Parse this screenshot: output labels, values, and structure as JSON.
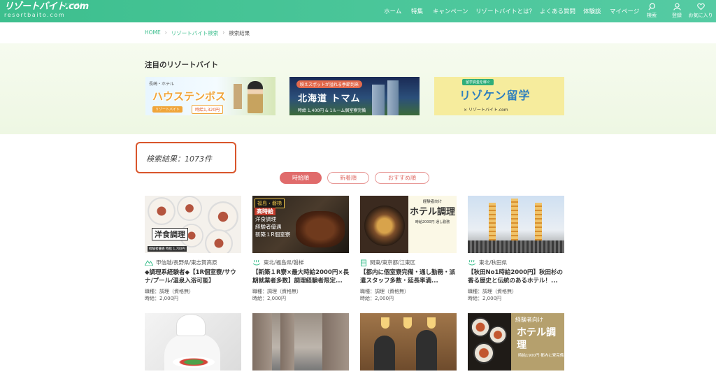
{
  "header": {
    "logo_text": "リゾートバイト.com",
    "logo_dotcom": "ドットコム",
    "logo_sub": "resortbaito.com",
    "nav": [
      {
        "label": "ホーム"
      },
      {
        "label": "特集"
      },
      {
        "label": "キャンペーン"
      },
      {
        "label": "リゾートバイトとは？"
      },
      {
        "label": "よくある質問"
      },
      {
        "label": "体験談"
      },
      {
        "label": "マイページ"
      }
    ],
    "icons": [
      {
        "label": "検索",
        "icon": "search-icon"
      },
      {
        "label": "登録",
        "icon": "user-icon"
      },
      {
        "label": "お気に入り",
        "icon": "heart-icon"
      }
    ]
  },
  "breadcrumb": {
    "home": "HOME",
    "section": "リゾートバイト検索",
    "current": "検索結果",
    "separator": "›"
  },
  "featured": {
    "title": "注目のリゾートバイト",
    "banners": [
      {
        "main": "ハウステンボス",
        "tag": "長崎・ホテル",
        "pill1": "リゾートバイト",
        "pill2": "時給1,320円"
      },
      {
        "tag": "映えスポットが溢れる季節到来",
        "main": "北海道 トマム",
        "sub": "時給 1,400円 & 1ルーム個室寮完備"
      },
      {
        "tag": "留学資金を稼ぐ",
        "main": "リゾケン留学",
        "sub": "× リゾートバイト.com"
      }
    ]
  },
  "results": {
    "count_text": "検索結果：1073件"
  },
  "sort": {
    "options": [
      {
        "label": "時給順",
        "active": true
      },
      {
        "label": "新着順",
        "active": false
      },
      {
        "label": "おすすめ順",
        "active": false
      }
    ]
  },
  "jobs": [
    {
      "area": "甲信越/長野県/東志賀高原",
      "title": "◆調理系経験者◆【1R個室寮/サウナ/プール/温泉入浴可能】",
      "job_type": "職種：調理（資格無）",
      "wage": "時給：2,000円",
      "thumb_label": "洋食調理",
      "thumb_strip": "経験者優遇 時給 1,700円"
    },
    {
      "area": "東北/福島県/磐梯",
      "title": "【新築１R寮×最大時給2000円×長期就業者多数】調理経験者限定...",
      "job_type": "職種：調理（資格無）",
      "wage": "時給：2,000円",
      "thumb_hdr": "福島・磐梯",
      "thumb_red": "高時給",
      "thumb_lines": [
        "洋食調理",
        "経験者優遇",
        "新築１R個室寮"
      ]
    },
    {
      "area": "関東/東京都/江東区",
      "title": "【都内に個室寮完備・通し勤務・派遣スタッフ多数・延長率満...",
      "job_type": "職種：調理（資格無）",
      "wage": "時給：2,000円",
      "thumb_p1": "経験者向け",
      "thumb_p2": "ホテル調理",
      "thumb_p3": "時給2000円 通し勤務"
    },
    {
      "area": "東北/秋田県",
      "title": "【秋田No1時給2000円】秋田杉の香る歴史と伝統のあるホテル！...",
      "job_type": "職種：調理（資格無）",
      "wage": "時給：2,000円"
    },
    {
      "thumb": "chef"
    },
    {
      "thumb": "street"
    },
    {
      "thumb": "restaurant"
    },
    {
      "thumb_p1": "経験者向け",
      "thumb_p2": "ホテル調理",
      "thumb_p3": "時給1900円 都内に寮完備"
    }
  ],
  "colors": {
    "brand_green": "#3dbf8e",
    "highlight_red": "#d9552b",
    "sort_active": "#e06b6b"
  }
}
